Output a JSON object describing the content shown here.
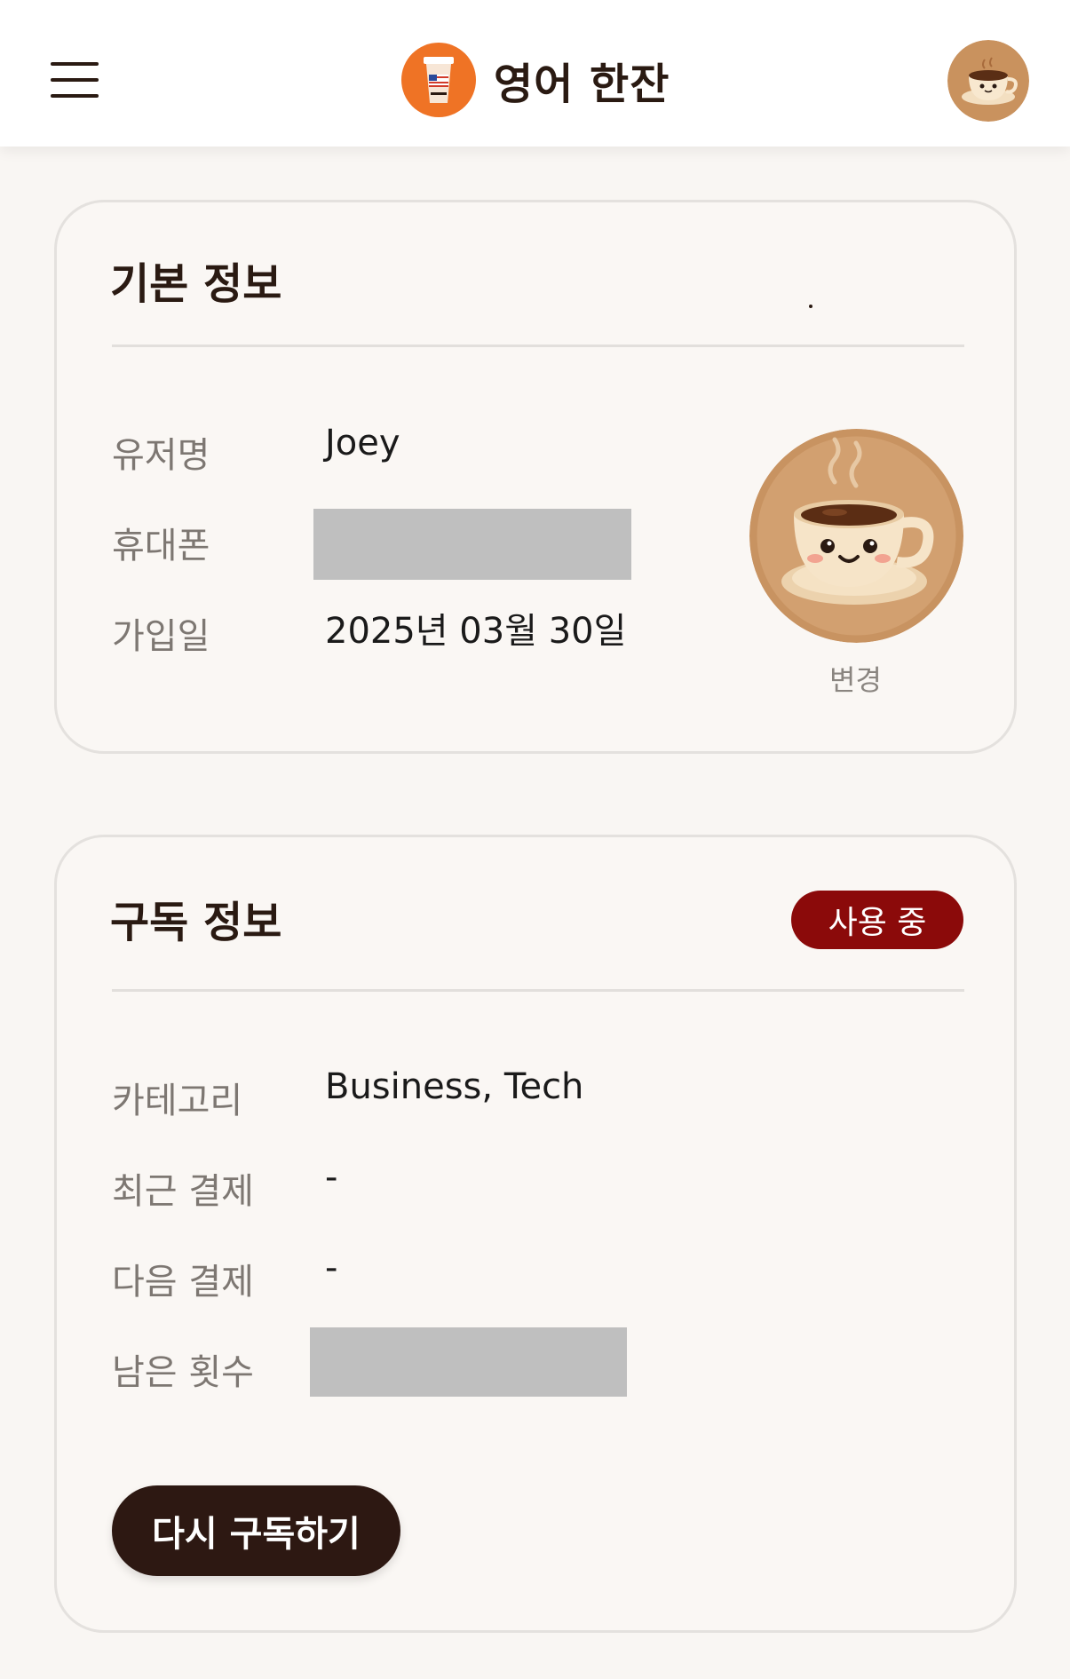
{
  "header": {
    "app_title": "영어 한잔",
    "menu_icon": "hamburger-menu-icon",
    "logo_icon": "coffee-cup-logo-icon",
    "avatar_icon": "coffee-cup-avatar-icon"
  },
  "basic_info": {
    "title": "기본 정보",
    "rows": [
      {
        "label": "유저명",
        "value": "Joey"
      },
      {
        "label": "휴대폰",
        "value": ""
      },
      {
        "label": "가입일",
        "value": "2025년 03월 30일"
      }
    ],
    "change_label": "변경"
  },
  "subscription": {
    "title": "구독 정보",
    "status_badge": "사용 중",
    "rows": [
      {
        "label": "카테고리",
        "value": "Business, Tech"
      },
      {
        "label": "최근 결제",
        "value": "-"
      },
      {
        "label": "다음 결제",
        "value": "-"
      },
      {
        "label": "남은 횟수",
        "value": ""
      }
    ],
    "resubscribe_label": "다시 구독하기"
  },
  "colors": {
    "brand_orange": "#ef7325",
    "badge_red": "#8b0a0a",
    "button_dark": "#2d1812",
    "background": "#f9f6f3"
  }
}
